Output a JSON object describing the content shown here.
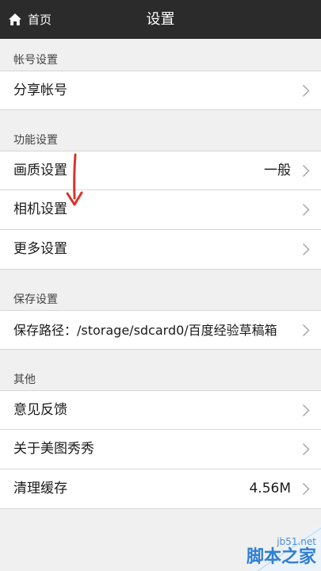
{
  "header": {
    "back_label": "首页",
    "title": "设置",
    "back_icon": "home-icon"
  },
  "sections": [
    {
      "title": "帐号设置",
      "items": [
        {
          "label": "分享帐号",
          "value": ""
        }
      ]
    },
    {
      "title": "功能设置",
      "items": [
        {
          "label": "画质设置",
          "value": "一般"
        },
        {
          "label": "相机设置",
          "value": ""
        },
        {
          "label": "更多设置",
          "value": ""
        }
      ]
    },
    {
      "title": "保存设置",
      "items": [
        {
          "label": "保存路径：/storage/sdcard0/百度经验草稿箱",
          "value": ""
        }
      ]
    },
    {
      "title": "其他",
      "items": [
        {
          "label": "意见反馈",
          "value": ""
        },
        {
          "label": "关于美图秀秀",
          "value": ""
        },
        {
          "label": "清理缓存",
          "value": "4.56M"
        }
      ]
    }
  ],
  "watermark": {
    "site": "jb51.net",
    "name": "脚本之家"
  },
  "colors": {
    "topbar": "#2b2b2b",
    "background": "#f0f0f0",
    "annotation_arrow": "#d9342b"
  }
}
